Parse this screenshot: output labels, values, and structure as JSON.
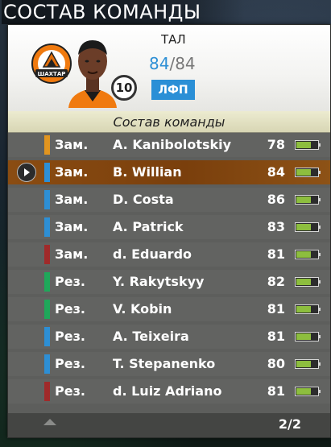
{
  "screen_title": "СОСТАВ КОМАНДЫ",
  "player": {
    "name": "ТАЛ",
    "rating_current": "84",
    "rating_separator": "/",
    "rating_max": "84",
    "number": "10",
    "position": "ЛФП",
    "club_crest_text": "ШАХТАР"
  },
  "section_title": "Состав команды",
  "rows": [
    {
      "role": "Зам.",
      "name": "A. Kanibolotskiy",
      "score": "78",
      "marker_color": "#e2951f",
      "fill": 0.7,
      "selected": false
    },
    {
      "role": "Зам.",
      "name": "B. Willian",
      "score": "84",
      "marker_color": "#2d8fd5",
      "fill": 0.7,
      "selected": true
    },
    {
      "role": "Зам.",
      "name": "D. Costa",
      "score": "86",
      "marker_color": "#2d8fd5",
      "fill": 0.7,
      "selected": false
    },
    {
      "role": "Зам.",
      "name": "A. Patrick",
      "score": "83",
      "marker_color": "#2d8fd5",
      "fill": 0.7,
      "selected": false
    },
    {
      "role": "Зам.",
      "name": "d. Eduardo",
      "score": "81",
      "marker_color": "#a02a2a",
      "fill": 0.7,
      "selected": false
    },
    {
      "role": "Рез.",
      "name": "Y. Rakytskyy",
      "score": "82",
      "marker_color": "#1fa85a",
      "fill": 0.7,
      "selected": false
    },
    {
      "role": "Рез.",
      "name": "V. Kobin",
      "score": "81",
      "marker_color": "#1fa85a",
      "fill": 0.7,
      "selected": false
    },
    {
      "role": "Рез.",
      "name": "A. Teixeira",
      "score": "81",
      "marker_color": "#2d8fd5",
      "fill": 0.7,
      "selected": false
    },
    {
      "role": "Рез.",
      "name": "T. Stepanenko",
      "score": "80",
      "marker_color": "#2d8fd5",
      "fill": 0.7,
      "selected": false
    },
    {
      "role": "Рез.",
      "name": "d. Luiz Adriano",
      "score": "81",
      "marker_color": "#a02a2a",
      "fill": 0.7,
      "selected": false
    }
  ],
  "pagination": "2/2",
  "icons": {
    "scroll_up": "up-arrow-icon",
    "play": "play-icon",
    "fitness": "battery-icon"
  },
  "colors": {
    "selected_row": "#8a4c12",
    "accent_blue": "#2d8fd5",
    "badge_bg": "#2a8fd6"
  }
}
